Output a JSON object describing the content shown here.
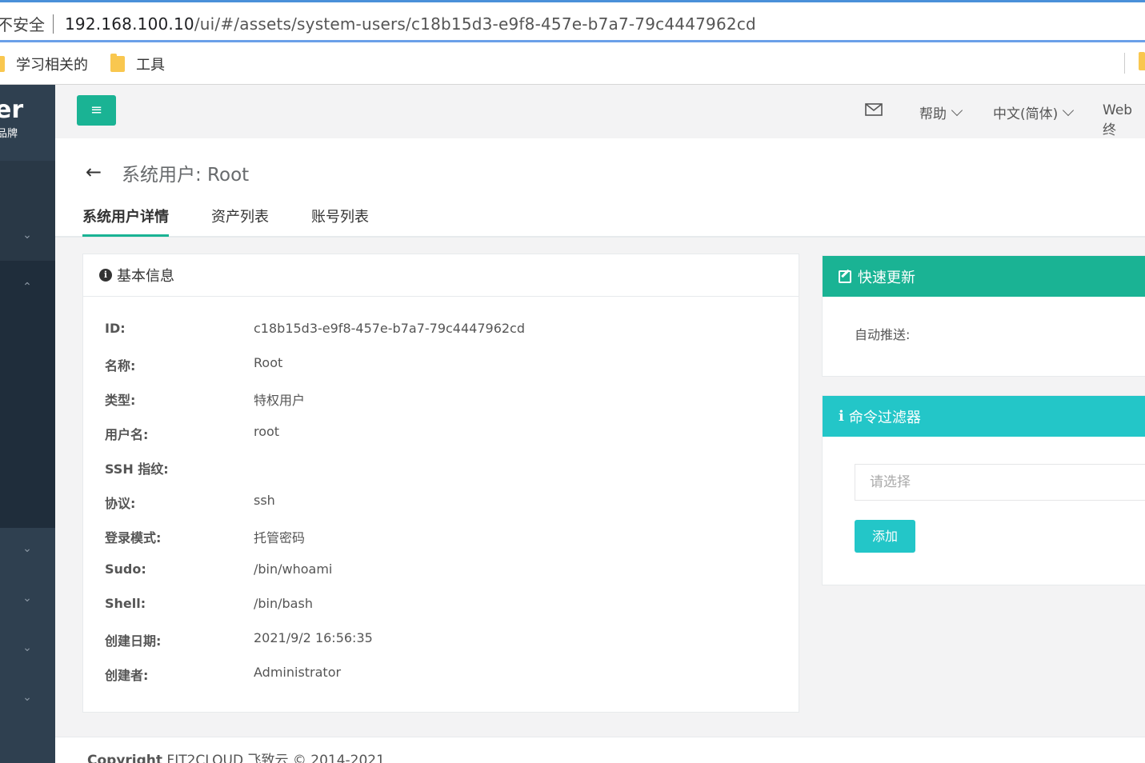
{
  "browser": {
    "security_label": "不安全",
    "url_host": "192.168.100.10",
    "url_path": "/ui/#/assets/system-users/c18b15d3-e9f8-457e-b7a7-79c4447962cd",
    "bookmarks": [
      {
        "label": "学习相关的",
        "icon": "folder-icon"
      },
      {
        "label": "工具",
        "icon": "folder-icon"
      }
    ]
  },
  "sidebar": {
    "logo_text": "er",
    "logo_sub": "品牌"
  },
  "topnav": {
    "menu_icon": "hamburger-icon",
    "mail_icon": "envelope-icon",
    "help": "帮助",
    "language": "中文(简体)",
    "web_terminal": "Web终"
  },
  "page": {
    "title": "系统用户: Root",
    "tabs": [
      {
        "label": "系统用户详情",
        "active": true
      },
      {
        "label": "资产列表",
        "active": false
      },
      {
        "label": "账号列表",
        "active": false
      }
    ]
  },
  "basic_info": {
    "header": "基本信息",
    "rows": [
      {
        "key": "ID:",
        "value": "c18b15d3-e9f8-457e-b7a7-79c4447962cd"
      },
      {
        "key": "名称:",
        "value": "Root"
      },
      {
        "key": "类型:",
        "value": "特权用户"
      },
      {
        "key": "用户名:",
        "value": "root"
      },
      {
        "key": "SSH 指纹:",
        "value": ""
      },
      {
        "key": "协议:",
        "value": "ssh"
      },
      {
        "key": "登录模式:",
        "value": "托管密码"
      },
      {
        "key": "Sudo:",
        "value": "/bin/whoami"
      },
      {
        "key": "Shell:",
        "value": "/bin/bash"
      },
      {
        "key": "创建日期:",
        "value": "2021/9/2 16:56:35"
      },
      {
        "key": "创建者:",
        "value": "Administrator"
      }
    ]
  },
  "quick_update": {
    "header": "快速更新",
    "auto_push_label": "自动推送:"
  },
  "command_filter": {
    "header": "命令过滤器",
    "select_placeholder": "请选择",
    "add_label": "添加"
  },
  "footer": {
    "copyright_bold": "Copyright",
    "copyright_rest": " FIT2CLOUD 飞致云 © 2014-2021"
  },
  "colors": {
    "primary": "#1ab394",
    "info": "#23c6c8",
    "sidebar": "#2f4050"
  }
}
